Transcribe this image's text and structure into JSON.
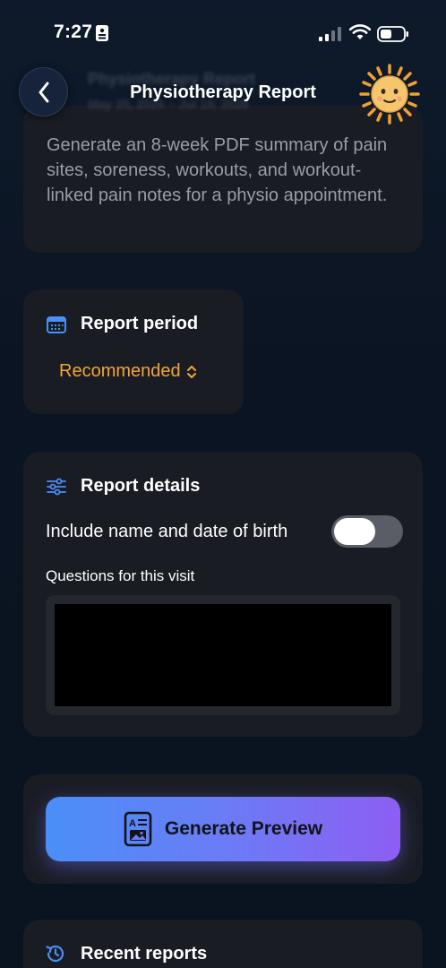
{
  "status_bar": {
    "time": "7:27",
    "icons": [
      "id-card-icon",
      "cellular-signal-icon",
      "wifi-icon",
      "battery-icon"
    ]
  },
  "header": {
    "title": "Physiotherapy Report",
    "back_icon": "chevron-left-icon",
    "mascot_icon": "sun-emoji-icon",
    "ghost_title": "Physiotherapy Report",
    "ghost_subtitle": "May 25, 2026 – Jul 19, 2026"
  },
  "intro": {
    "description": "Generate an 8-week PDF summary of pain sites, soreness, workouts, and workout-linked pain notes for a physio appointment."
  },
  "report_period": {
    "label": "Report period",
    "icon": "calendar-icon",
    "selected_value": "Recommended"
  },
  "report_details": {
    "label": "Report details",
    "icon": "sliders-icon",
    "include_name_dob_label": "Include name and date of birth",
    "include_name_dob_on": false,
    "questions_label": "Questions for this visit",
    "questions_value": ""
  },
  "generate": {
    "label": "Generate Preview",
    "icon": "document-preview-icon"
  },
  "recent_reports": {
    "label": "Recent reports",
    "icon": "history-clock-icon"
  },
  "colors": {
    "background": "#0c1523",
    "card": "#1a1c24",
    "accent_orange": "#f3a53a",
    "accent_blue": "#4a8ff7",
    "gradient_end": "#8d5ef3",
    "secondary_text": "#9a9ca6"
  }
}
